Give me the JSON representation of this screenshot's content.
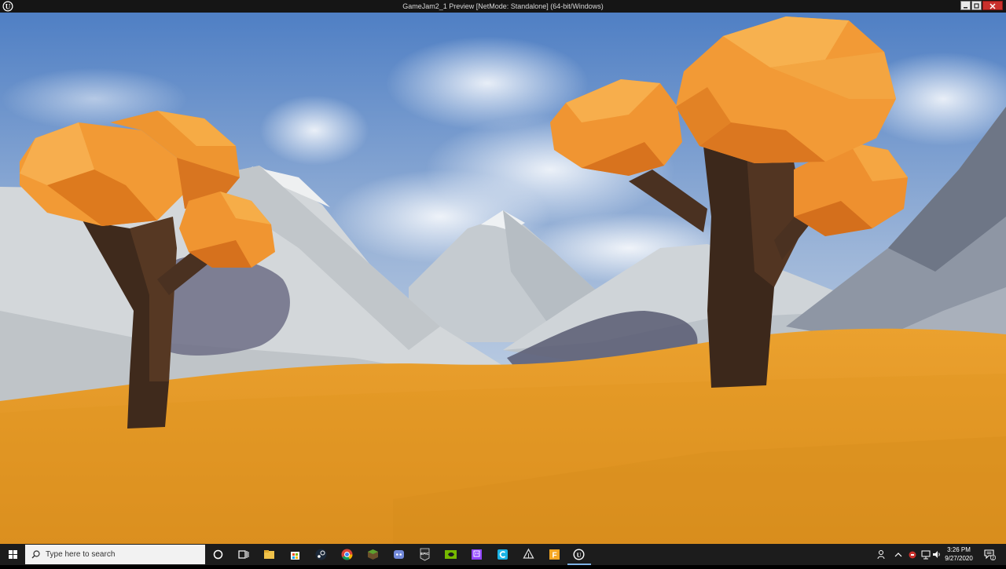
{
  "window": {
    "title": "GameJam2_1 Preview [NetMode: Standalone] (64-bit/Windows)",
    "logo_letter": "U"
  },
  "taskbar": {
    "search_placeholder": "Type here to search",
    "pinned_icons": [
      "cortana-icon",
      "task-view-icon",
      "file-explorer-icon",
      "store-icon",
      "steam-icon",
      "chrome-icon",
      "minecraft-icon",
      "discord-icon",
      "epic-games-icon",
      "nvidia-icon",
      "twitch-icon",
      "cortex-icon",
      "unity-icon",
      "fusion-icon",
      "unreal-engine-icon"
    ],
    "clock": {
      "time": "3:26 PM",
      "date": "9/27/2020"
    },
    "notification_count": "2"
  },
  "colors": {
    "sky_top": "#5a86c8",
    "ground": "#e29a2a",
    "foliage": "#f0962c",
    "trunk": "#4a3121",
    "taskbar": "#1c1c1c"
  }
}
